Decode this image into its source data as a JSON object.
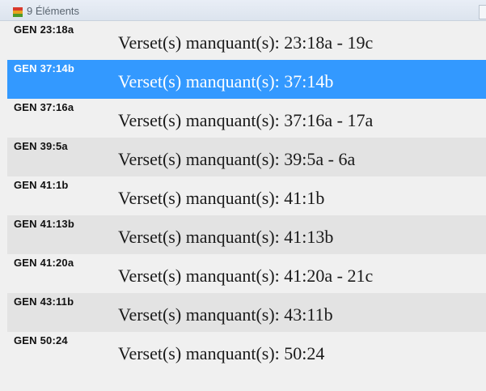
{
  "header": {
    "icon": "stacked-colored-box-icon",
    "count_label": "9 Éléments"
  },
  "selected_index": 1,
  "rows": [
    {
      "ref": "GEN 23:18a",
      "message": "Verset(s) manquant(s): 23:18a - 19c"
    },
    {
      "ref": "GEN 37:14b",
      "message": "Verset(s) manquant(s): 37:14b"
    },
    {
      "ref": "GEN 37:16a",
      "message": "Verset(s) manquant(s): 37:16a - 17a"
    },
    {
      "ref": "GEN 39:5a",
      "message": "Verset(s) manquant(s): 39:5a - 6a"
    },
    {
      "ref": "GEN 41:1b",
      "message": "Verset(s) manquant(s): 41:1b"
    },
    {
      "ref": "GEN 41:13b",
      "message": "Verset(s) manquant(s): 41:13b"
    },
    {
      "ref": "GEN 41:20a",
      "message": "Verset(s) manquant(s): 41:20a - 21c"
    },
    {
      "ref": "GEN 43:11b",
      "message": "Verset(s) manquant(s): 43:11b"
    },
    {
      "ref": "GEN 50:24",
      "message": "Verset(s) manquant(s): 50:24"
    }
  ],
  "colors": {
    "selection": "#3399ff",
    "alternate_row": "#e3e3e3",
    "background": "#f0f0f0"
  }
}
